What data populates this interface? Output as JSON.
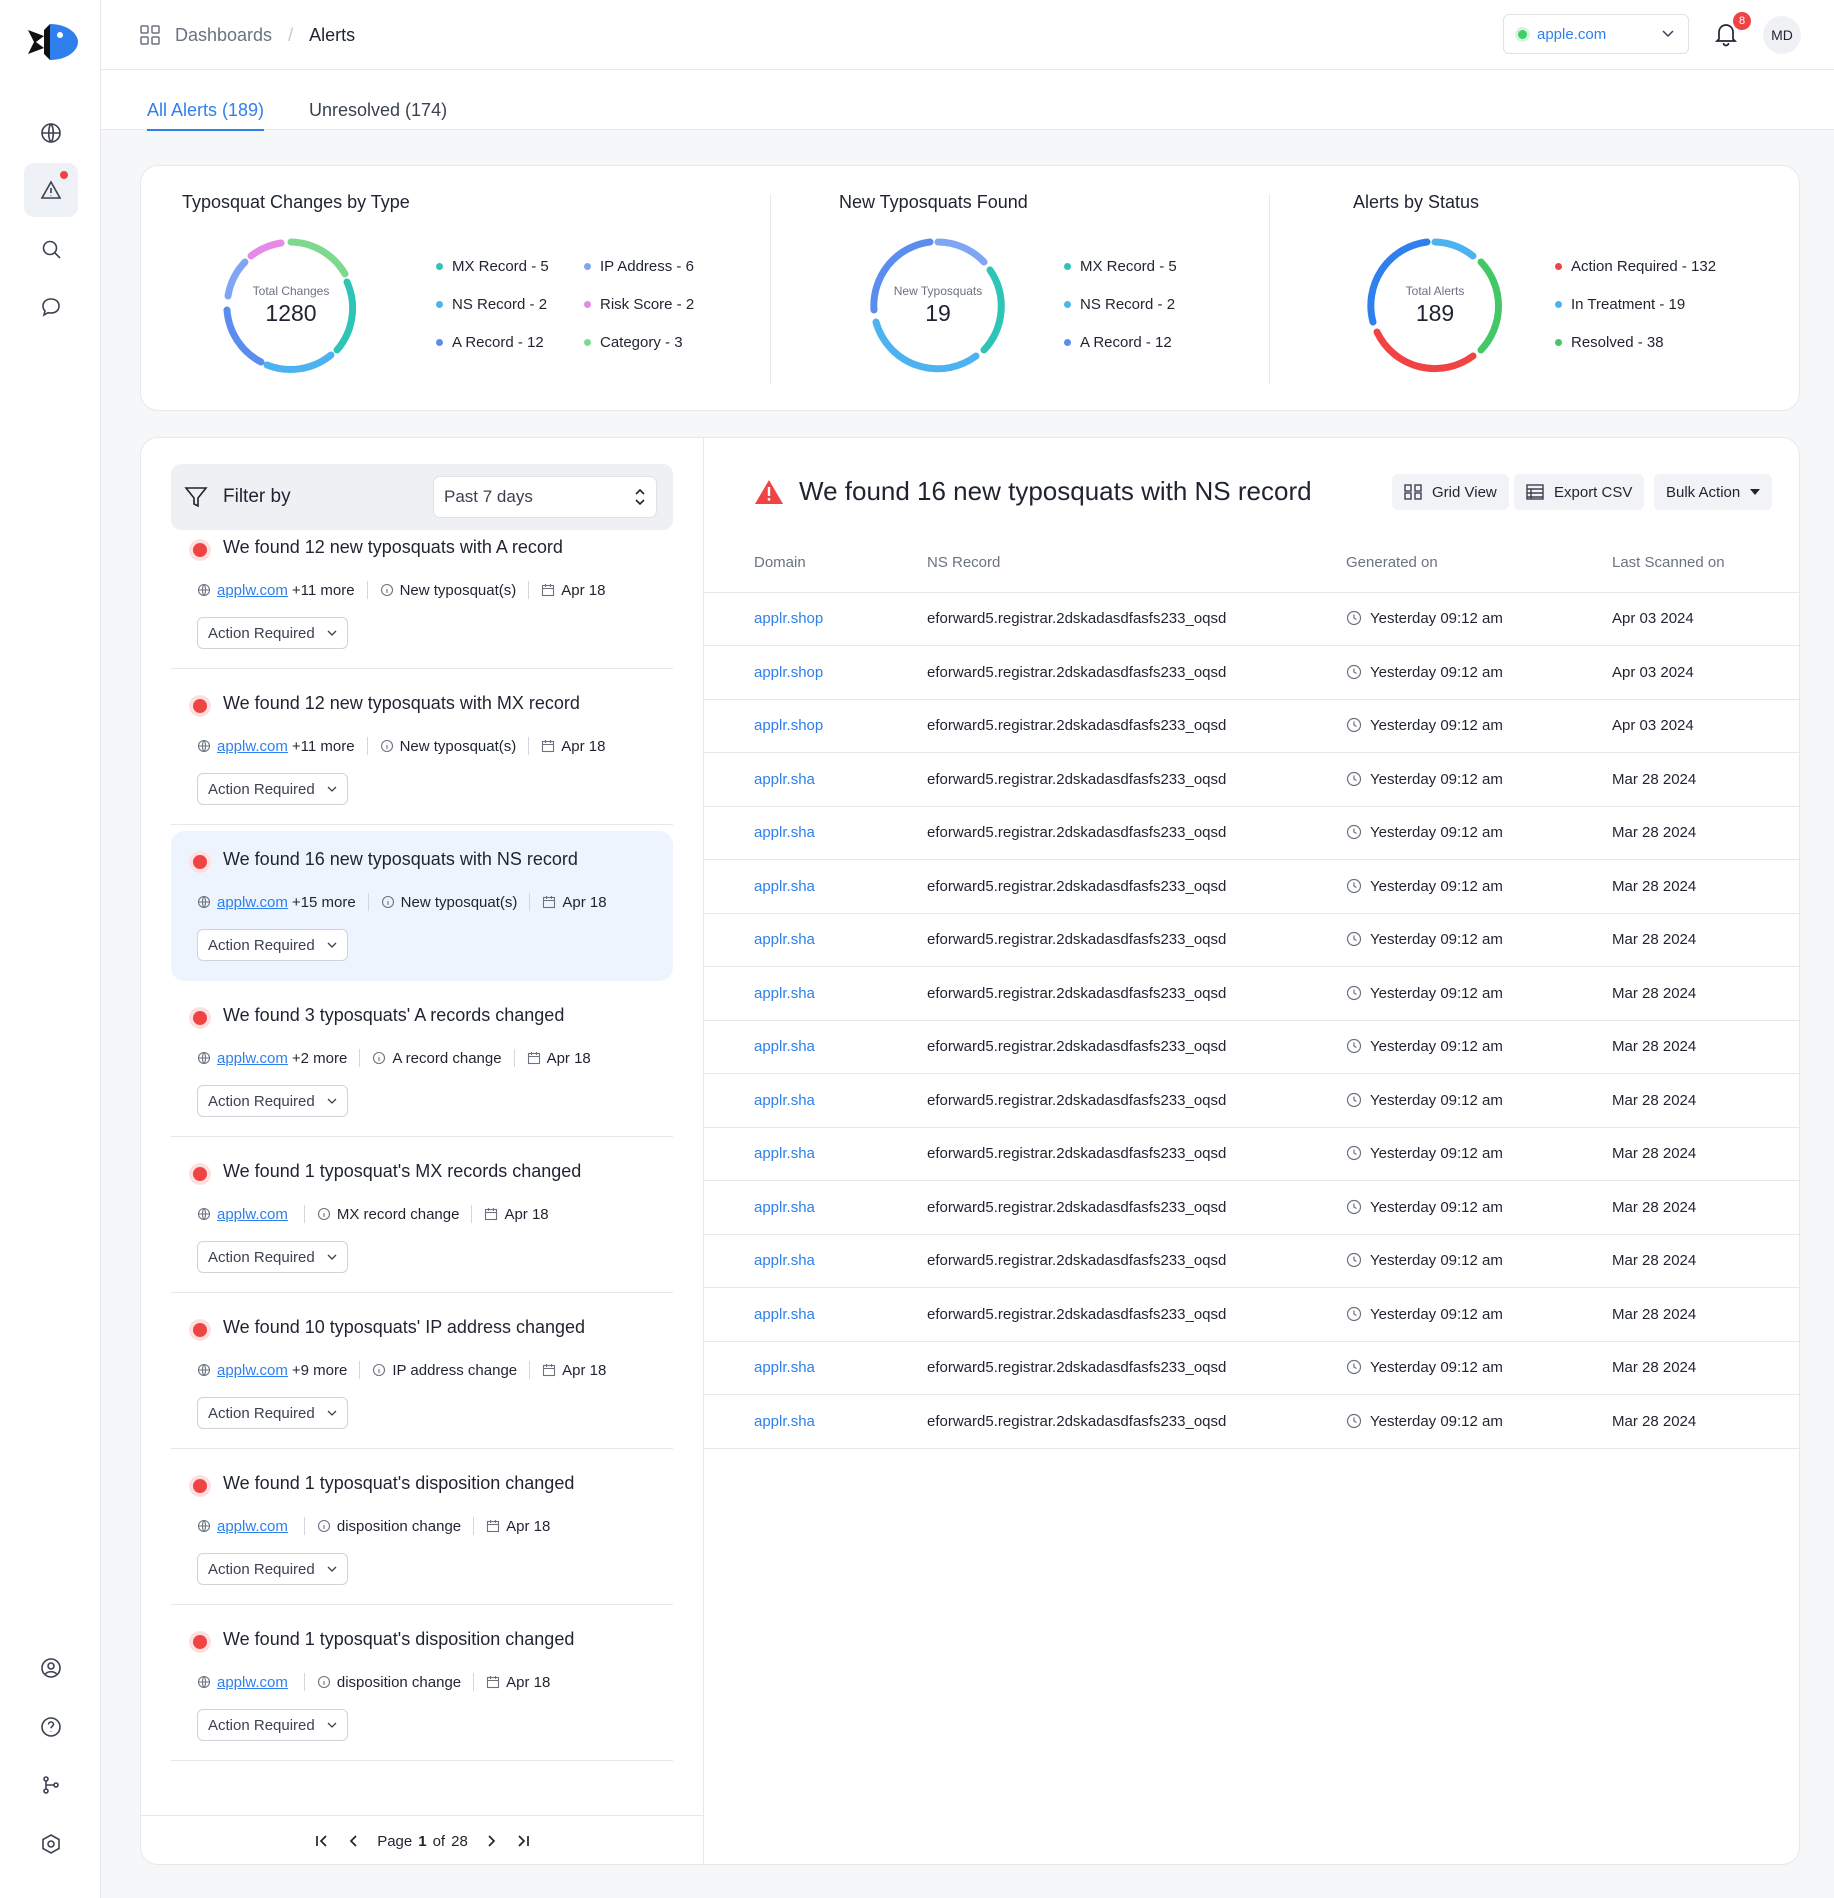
{
  "brand": {
    "logo_icon": "fish-logo"
  },
  "sidebar": {
    "top_icons": [
      "globe-icon",
      "alert-triangle-icon",
      "search-icon",
      "chat-icon"
    ],
    "bottom_icons": [
      "user-circle-icon",
      "help-icon",
      "git-branch-icon",
      "settings-icon"
    ]
  },
  "breadcrumb": {
    "parent": "Dashboards",
    "current": "Alerts"
  },
  "domain_selector": {
    "value": "apple.com"
  },
  "notifications": {
    "count": "8"
  },
  "user": {
    "initials": "MD"
  },
  "tabs": [
    {
      "label": "All Alerts (189)",
      "active": true
    },
    {
      "label": "Unresolved (174)",
      "active": false
    }
  ],
  "stats": {
    "typosquat_changes": {
      "title": "Typosquat Changes by Type",
      "center_label": "Total Changes",
      "center_value": "1280",
      "legend": [
        {
          "label": "MX Record - 5",
          "color": "#2ec4b6"
        },
        {
          "label": "IP Address - 6",
          "color": "#7fa6f5"
        },
        {
          "label": "NS Record - 2",
          "color": "#4db3f0"
        },
        {
          "label": "Risk Score - 2",
          "color": "#e58ae8"
        },
        {
          "label": "A Record -  12",
          "color": "#5b8def"
        },
        {
          "label": "Category - 3",
          "color": "#7ed98e"
        }
      ]
    },
    "new_typosquats": {
      "title": "New Typosquats Found",
      "center_label": "New Typosquats",
      "center_value": "19",
      "legend": [
        {
          "label": "MX Record - 5",
          "color": "#2ec4b6"
        },
        {
          "label": "NS Record - 2",
          "color": "#4db3f0"
        },
        {
          "label": "A Record -  12",
          "color": "#5b8def"
        }
      ]
    },
    "alerts_status": {
      "title": "Alerts by Status",
      "center_label": "Total Alerts",
      "center_value": "189",
      "legend": [
        {
          "label": "Action Required - 132",
          "color": "#f04444"
        },
        {
          "label": "In Treatment - 19",
          "color": "#4db3f0"
        },
        {
          "label": "Resolved -  38",
          "color": "#44c766"
        }
      ]
    }
  },
  "filter": {
    "label": "Filter by",
    "period": "Past 7 days"
  },
  "alerts": [
    {
      "title": "We found 12 new typosquats with A record",
      "domain": "applw.com",
      "more": "+11 more",
      "type": "New typosquat(s)",
      "date": "Apr 18",
      "status": "Action Required",
      "selected": false
    },
    {
      "title": "We found 12 new typosquats with MX record",
      "domain": "applw.com",
      "more": "+11 more",
      "type": "New typosquat(s)",
      "date": "Apr 18",
      "status": "Action Required",
      "selected": false
    },
    {
      "title": "We found 16 new typosquats with NS record",
      "domain": "applw.com",
      "more": "+15 more",
      "type": "New typosquat(s)",
      "date": "Apr 18",
      "status": "Action Required",
      "selected": true
    },
    {
      "title": "We found 3 typosquats' A records changed",
      "domain": "applw.com",
      "more": "+2 more",
      "type": "A record change",
      "date": "Apr 18",
      "status": "Action Required",
      "selected": false
    },
    {
      "title": "We found 1 typosquat's MX records changed",
      "domain": "applw.com",
      "more": "",
      "type": "MX record change",
      "date": "Apr 18",
      "status": "Action Required",
      "selected": false
    },
    {
      "title": "We found 10 typosquats' IP address changed",
      "domain": "applw.com",
      "more": "+9 more",
      "type": "IP address change",
      "date": "Apr 18",
      "status": "Action Required",
      "selected": false
    },
    {
      "title": "We found 1 typosquat's disposition changed",
      "domain": "applw.com",
      "more": "",
      "type": "disposition change",
      "date": "Apr 18",
      "status": "Action Required",
      "selected": false
    },
    {
      "title": "We found 1 typosquat's disposition changed",
      "domain": "applw.com",
      "more": "",
      "type": "disposition change",
      "date": "Apr 18",
      "status": "Action Required",
      "selected": false
    }
  ],
  "pagination": {
    "prefix": "Page",
    "current": "1",
    "of": "of",
    "total": "28"
  },
  "detail": {
    "title": "We found 16 new typosquats with NS record",
    "buttons": {
      "grid": "Grid View",
      "export": "Export CSV",
      "bulk": "Bulk Action"
    },
    "columns": [
      "Domain",
      "NS Record",
      "Generated on",
      "Last Scanned on"
    ],
    "rows": [
      [
        "applr.shop",
        "eforward5.registrar.2dskadasdfasfs233_oqsd",
        "Yesterday 09:12 am",
        "Apr 03 2024"
      ],
      [
        "applr.shop",
        "eforward5.registrar.2dskadasdfasfs233_oqsd",
        "Yesterday 09:12 am",
        "Apr 03 2024"
      ],
      [
        "applr.shop",
        "eforward5.registrar.2dskadasdfasfs233_oqsd",
        "Yesterday 09:12 am",
        "Apr 03 2024"
      ],
      [
        "applr.sha",
        "eforward5.registrar.2dskadasdfasfs233_oqsd",
        "Yesterday 09:12 am",
        "Mar 28 2024"
      ],
      [
        "applr.sha",
        "eforward5.registrar.2dskadasdfasfs233_oqsd",
        "Yesterday 09:12 am",
        "Mar 28 2024"
      ],
      [
        "applr.sha",
        "eforward5.registrar.2dskadasdfasfs233_oqsd",
        "Yesterday 09:12 am",
        "Mar 28 2024"
      ],
      [
        "applr.sha",
        "eforward5.registrar.2dskadasdfasfs233_oqsd",
        "Yesterday 09:12 am",
        "Mar 28 2024"
      ],
      [
        "applr.sha",
        "eforward5.registrar.2dskadasdfasfs233_oqsd",
        "Yesterday 09:12 am",
        "Mar 28 2024"
      ],
      [
        "applr.sha",
        "eforward5.registrar.2dskadasdfasfs233_oqsd",
        "Yesterday 09:12 am",
        "Mar 28 2024"
      ],
      [
        "applr.sha",
        "eforward5.registrar.2dskadasdfasfs233_oqsd",
        "Yesterday 09:12 am",
        "Mar 28 2024"
      ],
      [
        "applr.sha",
        "eforward5.registrar.2dskadasdfasfs233_oqsd",
        "Yesterday 09:12 am",
        "Mar 28 2024"
      ],
      [
        "applr.sha",
        "eforward5.registrar.2dskadasdfasfs233_oqsd",
        "Yesterday 09:12 am",
        "Mar 28 2024"
      ],
      [
        "applr.sha",
        "eforward5.registrar.2dskadasdfasfs233_oqsd",
        "Yesterday 09:12 am",
        "Mar 28 2024"
      ],
      [
        "applr.sha",
        "eforward5.registrar.2dskadasdfasfs233_oqsd",
        "Yesterday 09:12 am",
        "Mar 28 2024"
      ],
      [
        "applr.sha",
        "eforward5.registrar.2dskadasdfasfs233_oqsd",
        "Yesterday 09:12 am",
        "Mar 28 2024"
      ],
      [
        "applr.sha",
        "eforward5.registrar.2dskadasdfasfs233_oqsd",
        "Yesterday 09:12 am",
        "Mar 28 2024"
      ]
    ]
  }
}
